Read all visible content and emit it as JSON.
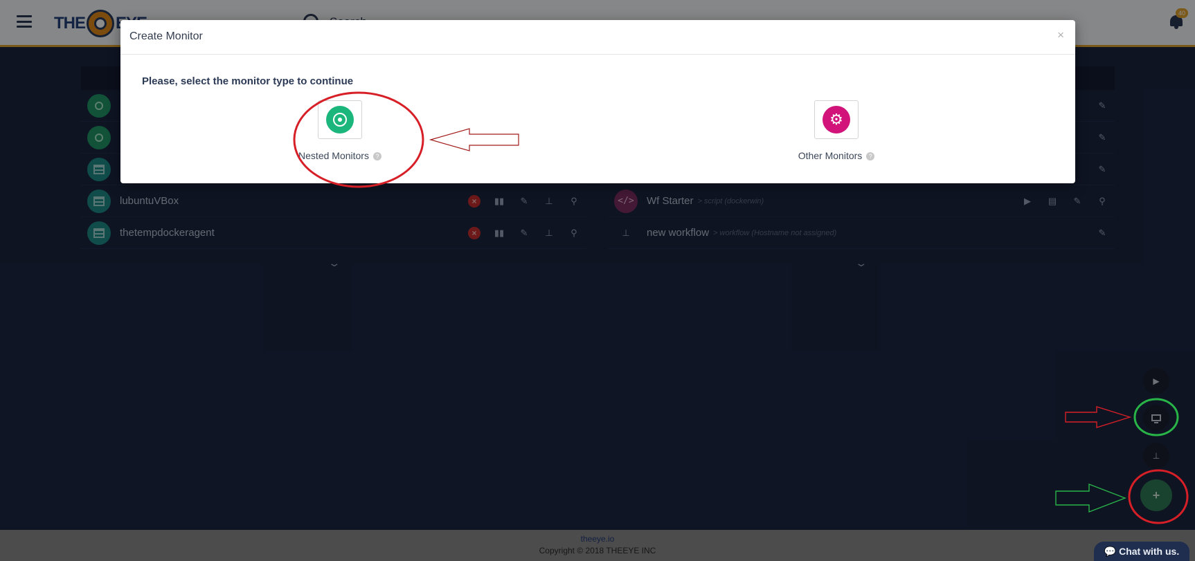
{
  "header": {
    "logo_text": "THE EYE",
    "search_placeholder": "Search",
    "notification_count": "40"
  },
  "left_panel": {
    "rows": [
      {
        "name": "",
        "icon": "target-icon"
      },
      {
        "name": "",
        "icon": "target-icon"
      },
      {
        "name": "",
        "icon": "server-icon"
      },
      {
        "name": "lubuntuVBox",
        "icon": "server-icon"
      },
      {
        "name": "thetempdockeragent",
        "icon": "server-icon"
      }
    ],
    "row_actions": [
      "remove-icon",
      "stats-icon",
      "edit-icon",
      "workflow-icon",
      "search-icon"
    ]
  },
  "right_panel": {
    "rows": [
      {
        "name": "Wf Starter",
        "subtitle": "> script (dockerwin)",
        "icon": "code-icon"
      },
      {
        "name": "new workflow",
        "subtitle": "> workflow (Hostname not assigned)",
        "icon": "workflow-icon"
      }
    ]
  },
  "modal": {
    "title": "Create Monitor",
    "close": "×",
    "prompt": "Please, select the monitor type to continue",
    "choices": [
      {
        "label": "Nested Monitors",
        "icon": "target-icon",
        "color": "#1bb67c"
      },
      {
        "label": "Other Monitors",
        "icon": "gears-icon",
        "color": "#d1137a"
      }
    ],
    "help_glyph": "?"
  },
  "floating_buttons": {
    "play": "▶",
    "add": "+"
  },
  "annotation_colors": {
    "red": "#d61f26",
    "green": "#28b447"
  },
  "footer": {
    "link": "theeye.io",
    "copyright": "Copyright © 2018 THEEYE INC",
    "chat": "Chat with us."
  }
}
